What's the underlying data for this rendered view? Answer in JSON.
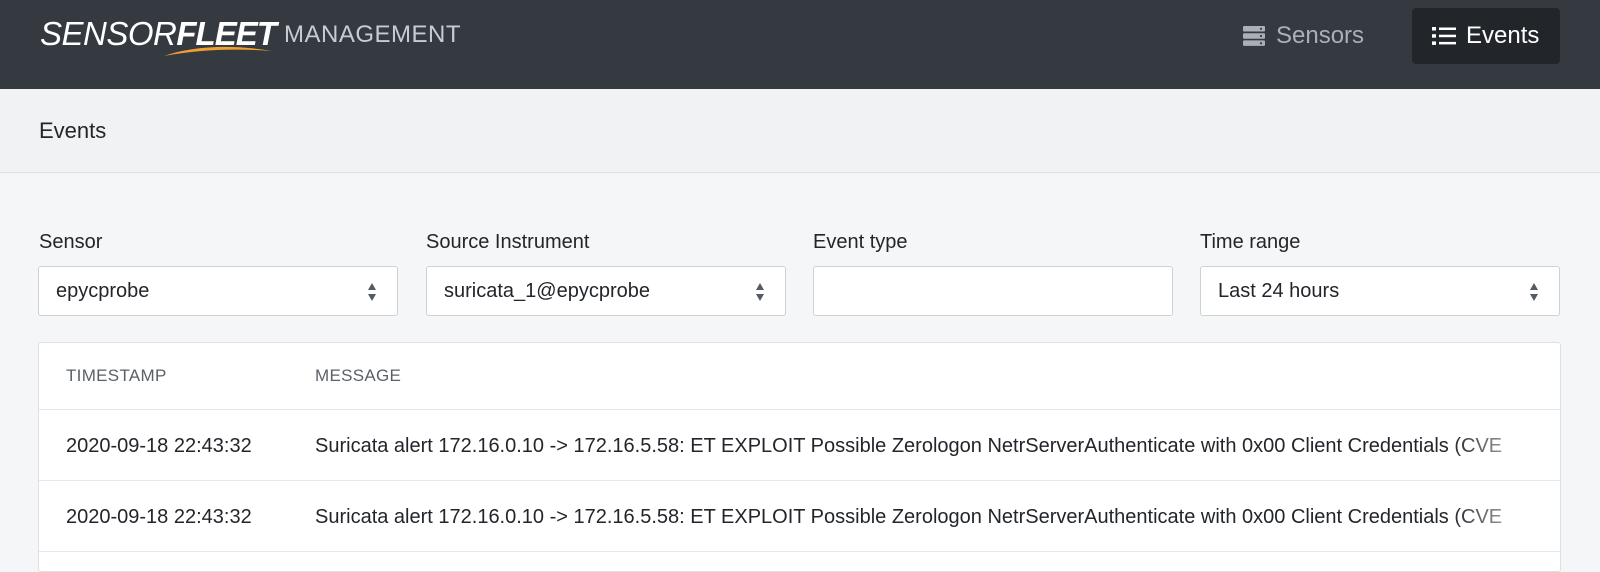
{
  "brand": {
    "part1": "SENSOR",
    "part2": "FLEET",
    "subtitle": "MANAGEMENT",
    "accent": "#f0a030"
  },
  "nav": [
    {
      "label": "Sensors",
      "icon": "server-icon",
      "active": false
    },
    {
      "label": "Events",
      "icon": "list-icon",
      "active": true
    }
  ],
  "page": {
    "title": "Events"
  },
  "filters": {
    "sensor": {
      "label": "Sensor",
      "value": "epycprobe"
    },
    "source_instrument": {
      "label": "Source Instrument",
      "value": "suricata_1@epycprobe"
    },
    "event_type": {
      "label": "Event type",
      "value": ""
    },
    "time_range": {
      "label": "Time range",
      "value": "Last 24 hours"
    }
  },
  "table": {
    "columns": [
      "TIMESTAMP",
      "MESSAGE"
    ],
    "rows": [
      {
        "timestamp": "2020-09-18 22:43:32",
        "message": "Suricata alert 172.16.0.10 -> 172.16.5.58: ET EXPLOIT Possible Zerologon NetrServerAuthenticate with 0x00 Client Credentials (CVE"
      },
      {
        "timestamp": "2020-09-18 22:43:32",
        "message": "Suricata alert 172.16.0.10 -> 172.16.5.58: ET EXPLOIT Possible Zerologon NetrServerAuthenticate with 0x00 Client Credentials (CVE"
      }
    ]
  },
  "colors": {
    "topbar": "#343a40",
    "active_nav": "#22262b",
    "background": "#f5f6f8"
  }
}
